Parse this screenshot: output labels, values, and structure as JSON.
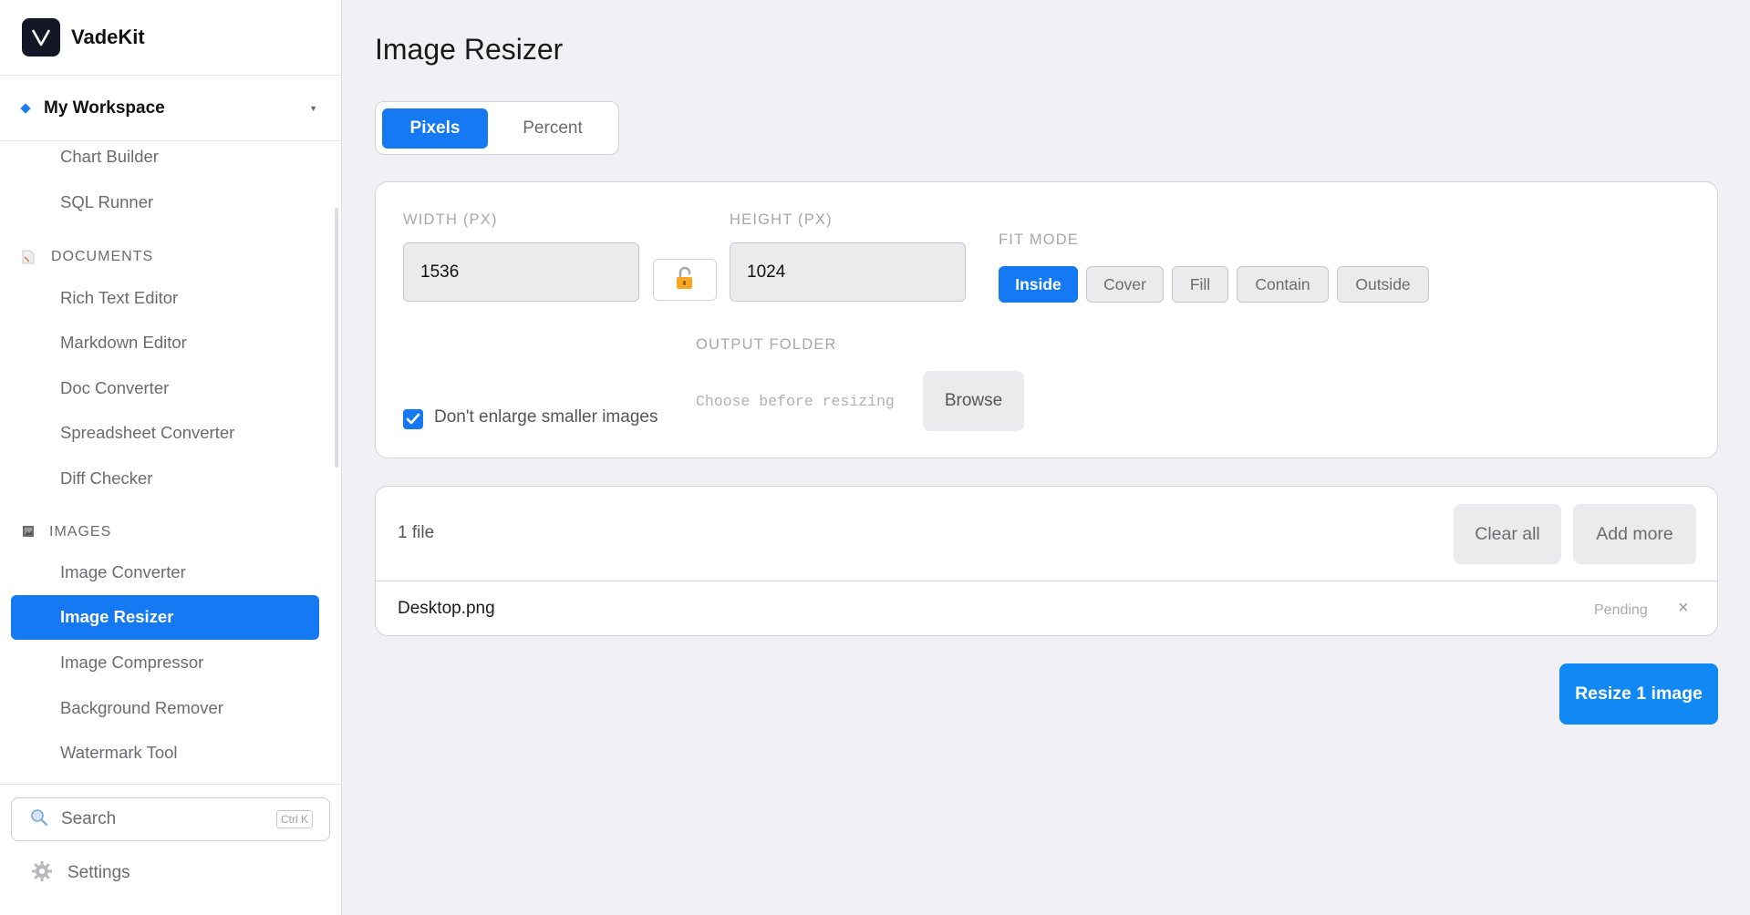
{
  "app": {
    "name": "VadeKit"
  },
  "workspace": {
    "name": "My Workspace"
  },
  "sidebar": {
    "top_items": [
      "Chart Builder",
      "SQL Runner"
    ],
    "documents": {
      "title": "DOCUMENTS",
      "items": [
        "Rich Text Editor",
        "Markdown Editor",
        "Doc Converter",
        "Spreadsheet Converter",
        "Diff Checker"
      ]
    },
    "images": {
      "title": "IMAGES",
      "items": [
        "Image Converter",
        "Image Resizer",
        "Image Compressor",
        "Background Remover",
        "Watermark Tool"
      ],
      "active": "Image Resizer"
    },
    "search": {
      "label": "Search",
      "shortcut": "Ctrl K"
    },
    "settings": "Settings"
  },
  "page": {
    "title": "Image Resizer"
  },
  "unit_toggle": {
    "options": [
      "Pixels",
      "Percent"
    ],
    "selected": "Pixels"
  },
  "dimensions": {
    "width_label": "WIDTH (PX)",
    "width_value": "1536",
    "height_label": "HEIGHT (PX)",
    "height_value": "1024",
    "aspect_lock": "unlocked"
  },
  "fit_mode": {
    "label": "FIT MODE",
    "options": [
      "Inside",
      "Cover",
      "Fill",
      "Contain",
      "Outside"
    ],
    "selected": "Inside"
  },
  "options": {
    "no_enlarge_label": "Don't enlarge smaller images",
    "no_enlarge_checked": true
  },
  "output_folder": {
    "label": "OUTPUT FOLDER",
    "placeholder": "Choose before resizing",
    "browse_label": "Browse"
  },
  "files": {
    "count_label": "1 file",
    "clear_label": "Clear all",
    "add_label": "Add more",
    "items": [
      {
        "name": "Desktop.png",
        "status": "Pending"
      }
    ]
  },
  "action": {
    "label": "Resize 1 image"
  },
  "colors": {
    "accent": "#1479f2",
    "action": "#1189f5"
  }
}
